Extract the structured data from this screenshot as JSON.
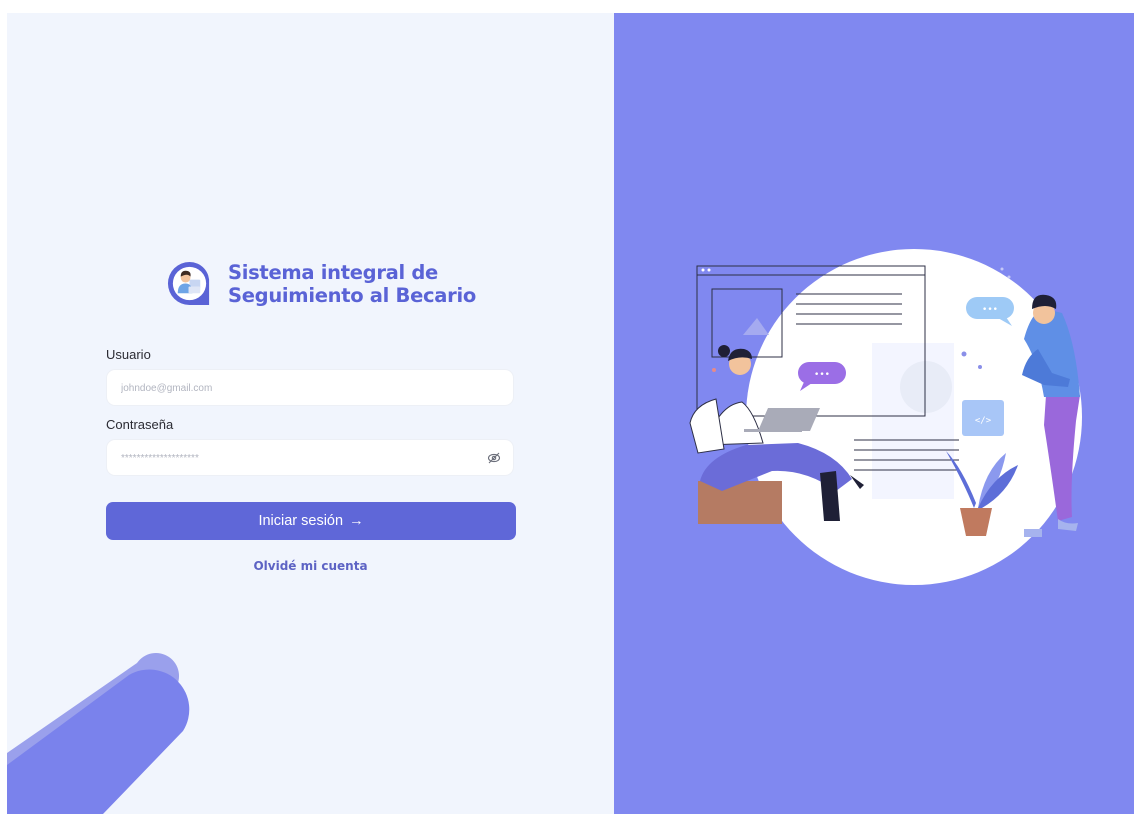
{
  "brand": {
    "line1": "Sistema integral de",
    "line2": "Seguimiento al Becario",
    "logo_icon": "student-avatar-icon"
  },
  "login": {
    "username_label": "Usuario",
    "username_placeholder": "johndoe@gmail.com",
    "password_label": "Contraseña",
    "password_placeholder": "********************",
    "toggle_icon": "eye-slash-icon",
    "submit_label": "Iniciar sesión",
    "submit_icon": "arrow-right",
    "submit_arrow": "→",
    "forgot_label": "Olvidé mi cuenta"
  },
  "illustration": {
    "code_tag": "</>",
    "chat_dots": "•••"
  },
  "colors": {
    "left_background": "#f1f5fd",
    "right_background": "#8088f0",
    "brand": "#5a63d6",
    "button": "#5f67d8"
  }
}
